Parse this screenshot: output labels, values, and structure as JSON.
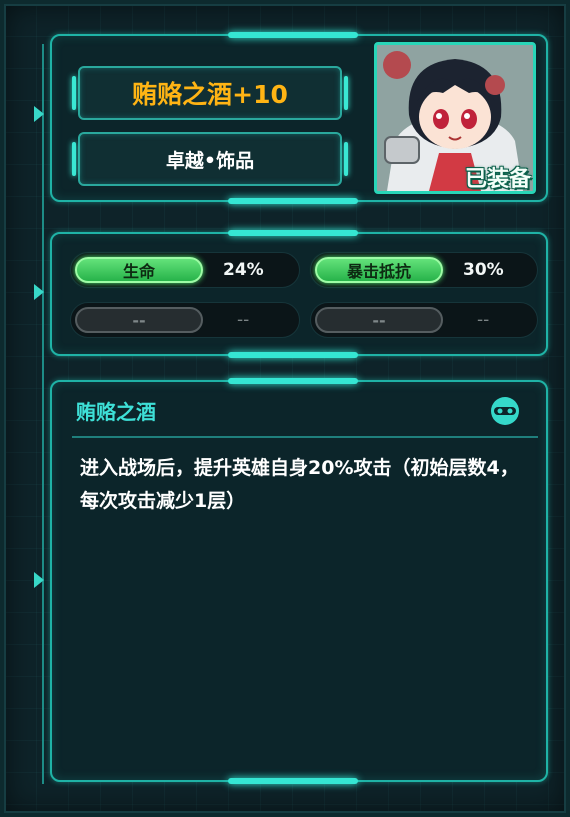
{
  "item": {
    "name": "贿赂之酒+10",
    "quality": "卓越•饰品",
    "equipped_label": "已装备"
  },
  "stats": [
    {
      "label": "生命",
      "value": "24%",
      "active": true
    },
    {
      "label": "暴击抵抗",
      "value": "30%",
      "active": true
    },
    {
      "label": "--",
      "value": "--",
      "active": false
    },
    {
      "label": "--",
      "value": "--",
      "active": false
    }
  ],
  "description": {
    "title": "贿赂之酒",
    "text": "进入战场后，提升英雄自身20%攻击（初始层数4，每次攻击减少1层）",
    "icon": "mask-icon"
  },
  "colors": {
    "accent": "#35e6d3",
    "title_gold": "#ffb414",
    "stat_green": "#4fea6b"
  }
}
